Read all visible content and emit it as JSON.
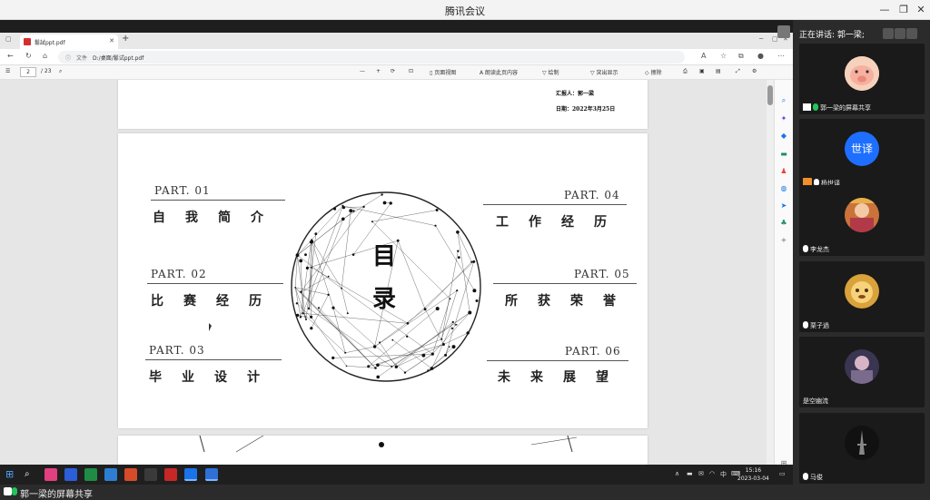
{
  "app": {
    "title": "腾讯会议"
  },
  "window_controls": {
    "minimize": "—",
    "restore": "❐",
    "close": "✕"
  },
  "browser": {
    "tab_title": "鬈試ppt.pdf",
    "tab_close": "✕",
    "tab_add": "+",
    "address_label": "文件",
    "address": "D:/桌面/鬈试ppt.pdf"
  },
  "pdf_toolbar": {
    "page_current": "2",
    "page_total": "/ 23",
    "page_view": "页面视图",
    "read_aloud": "朗读此页内容",
    "draw": "绘制",
    "highlight": "突出显示",
    "erase": "擦除",
    "zoom_out": "—",
    "zoom_in": "+"
  },
  "slide_top": {
    "reporter": "汇报人：郭一梁",
    "date": "日期：2022年3月25日"
  },
  "slide_toc": {
    "center_top": "目",
    "center_bottom": "录",
    "items": [
      {
        "part": "PART. 01",
        "title": "自我简介"
      },
      {
        "part": "PART. 02",
        "title": "比赛经历"
      },
      {
        "part": "PART. 03",
        "title": "毕业设计"
      },
      {
        "part": "PART. 04",
        "title": "工作经历"
      },
      {
        "part": "PART. 05",
        "title": "所获荣誉"
      },
      {
        "part": "PART. 06",
        "title": "未来展望"
      }
    ]
  },
  "taskbar": {
    "time": "15:16",
    "date": "2023-03-04",
    "ime": "中"
  },
  "status_strip": {
    "text": "郭一梁的屏幕共享"
  },
  "meeting": {
    "speaking": "正在讲话: 郭一梁;",
    "participants": [
      {
        "name": "郭一梁的屏幕共享",
        "avatar": "pig",
        "share": true
      },
      {
        "name": "杨世译",
        "avatar": "text",
        "avatar_text": "世译"
      },
      {
        "name": "李龙杰",
        "avatar": "photo1"
      },
      {
        "name": "栗子過",
        "avatar": "photo2"
      },
      {
        "name": "是空幽流",
        "avatar": "photo3"
      },
      {
        "name": "马俊",
        "avatar": "tower"
      }
    ]
  },
  "colors": {
    "accent_green": "#21c35b",
    "brand_blue": "#1e6fff"
  }
}
